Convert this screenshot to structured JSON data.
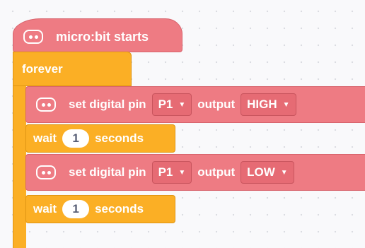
{
  "hat_block": {
    "label": "micro:bit starts",
    "icon": "microbit-icon"
  },
  "forever_block": {
    "label": "forever"
  },
  "blocks": [
    {
      "type": "set-digital-pin",
      "label": "set digital pin",
      "pin": "P1",
      "output_label": "output",
      "value": "HIGH"
    },
    {
      "type": "wait",
      "label": "wait",
      "seconds": "1",
      "unit": "seconds"
    },
    {
      "type": "set-digital-pin",
      "label": "set digital pin",
      "pin": "P1",
      "output_label": "output",
      "value": "LOW"
    },
    {
      "type": "wait",
      "label": "wait",
      "seconds": "1",
      "unit": "seconds"
    }
  ],
  "colors": {
    "pins_category": "#ee7b83",
    "control_category": "#fbaf25",
    "workspace_background": "#f9f9fb"
  }
}
